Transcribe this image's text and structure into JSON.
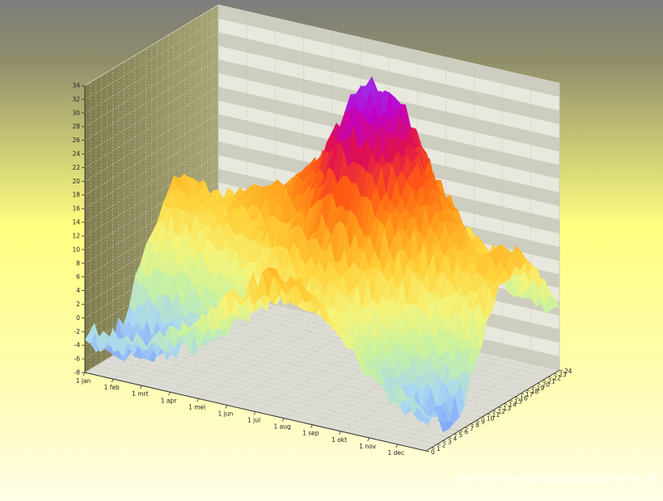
{
  "chart_data": {
    "type": "surface-3d",
    "title": "",
    "xlabel": "",
    "ylabel": "",
    "zlabel": "",
    "x_ticks": [
      "1 jan",
      "1 feb",
      "1 mrt",
      "1 apr",
      "1 mei",
      "1 jun",
      "1 jul",
      "1 aug",
      "1 sep",
      "1 okt",
      "1 nov",
      "1 dec"
    ],
    "y_ticks": [
      "0",
      "1",
      "2",
      "3",
      "4",
      "5",
      "6",
      "7",
      "8",
      "9",
      "10",
      "11",
      "12",
      "13",
      "14",
      "15",
      "16",
      "17",
      "18",
      "19",
      "20",
      "21",
      "22",
      "23",
      "24"
    ],
    "z_ticks": [
      "-8",
      "-6",
      "-4",
      "-2",
      "0",
      "2",
      "4",
      "6",
      "8",
      "10",
      "12",
      "14",
      "16",
      "18",
      "20",
      "22",
      "24",
      "26",
      "28",
      "30",
      "32",
      "34"
    ],
    "z_range": [
      -8,
      34
    ],
    "y_range": [
      0,
      24
    ],
    "grid": true,
    "monthly_min": [
      -6,
      -6,
      -4,
      -2,
      2,
      5,
      8,
      7,
      5,
      0,
      -4,
      -5
    ],
    "monthly_max": [
      11,
      11,
      12,
      14,
      17,
      22,
      32,
      30,
      20,
      14,
      11,
      12
    ],
    "colorscale": [
      "#6d8dff",
      "#a9d6f2",
      "#c8f2a0",
      "#f5f57a",
      "#ffd23a",
      "#ff9a1a",
      "#ff5a12",
      "#e01050",
      "#c000c8",
      "#8a4bff"
    ]
  },
  "watermark": "www.weerstationhaaksbergen.nl"
}
